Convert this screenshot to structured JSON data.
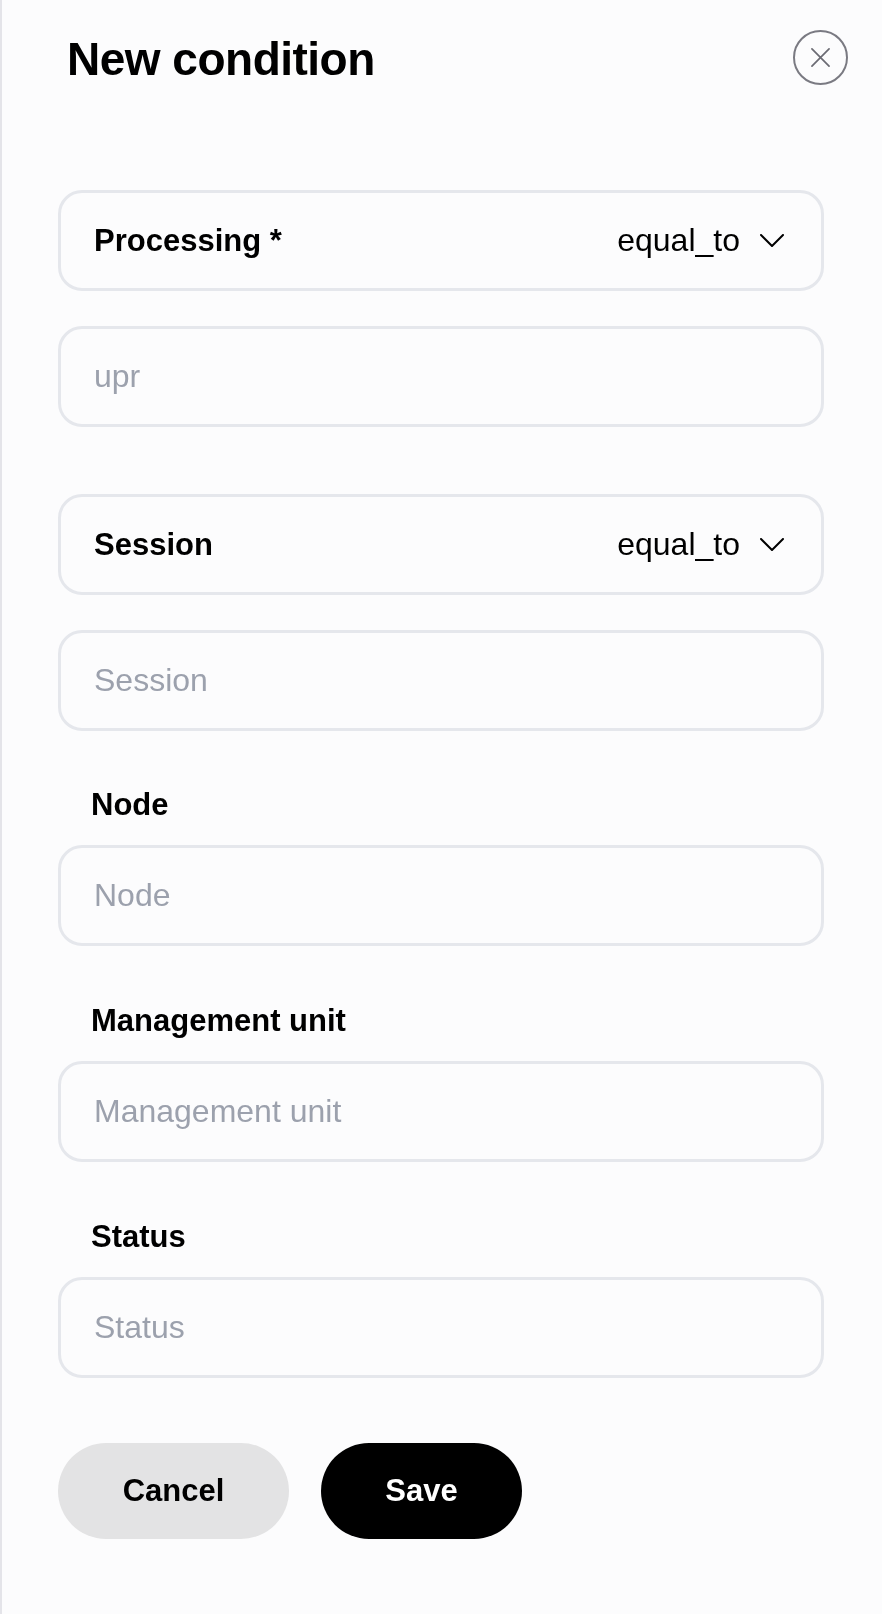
{
  "title": "New condition",
  "conditions": [
    {
      "label": "Processing *",
      "operator": "equal_to",
      "placeholder": "upr"
    },
    {
      "label": "Session",
      "operator": "equal_to",
      "placeholder": "Session"
    }
  ],
  "fields": [
    {
      "label": "Node",
      "placeholder": "Node"
    },
    {
      "label": "Management unit",
      "placeholder": "Management unit"
    },
    {
      "label": "Status",
      "placeholder": "Status"
    }
  ],
  "buttons": [
    {
      "label": "Cancel",
      "kind": "secondary"
    },
    {
      "label": "Save",
      "kind": "primary"
    }
  ]
}
